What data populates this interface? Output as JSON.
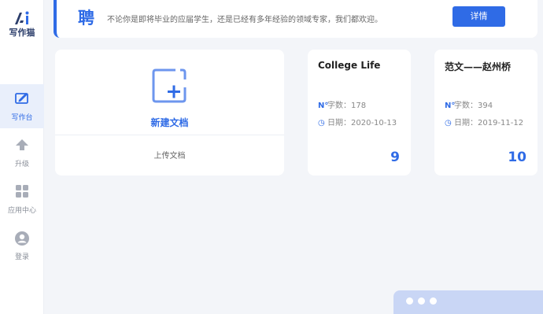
{
  "app": {
    "logo_text": "写作猫"
  },
  "sidebar": {
    "items": [
      {
        "label": "写作台",
        "icon": "pen-icon",
        "active": true
      },
      {
        "label": "升级",
        "icon": "arrow-up-icon",
        "active": false
      },
      {
        "label": "应用中心",
        "icon": "grid-icon",
        "active": false
      },
      {
        "label": "登录",
        "icon": "user-icon",
        "active": false
      }
    ]
  },
  "banner": {
    "char": "聘",
    "text": "不论你是即将毕业的应届学生，还是已经有多年经验的领域专家，我们都欢迎。",
    "button_label": "详情"
  },
  "new_doc": {
    "label": "新建文档",
    "upload_label": "上传文档"
  },
  "documents": [
    {
      "title": "College Life",
      "words_label": "字数：",
      "words": "178",
      "date_label": "日期：",
      "date": "2020-10-13",
      "count": "9"
    },
    {
      "title": "范文——赵州桥",
      "words_label": "字数：",
      "words": "394",
      "date_label": "日期：",
      "date": "2019-11-12",
      "count": "10"
    }
  ],
  "colors": {
    "accent": "#2f6be6",
    "background": "#f3f5f9"
  }
}
